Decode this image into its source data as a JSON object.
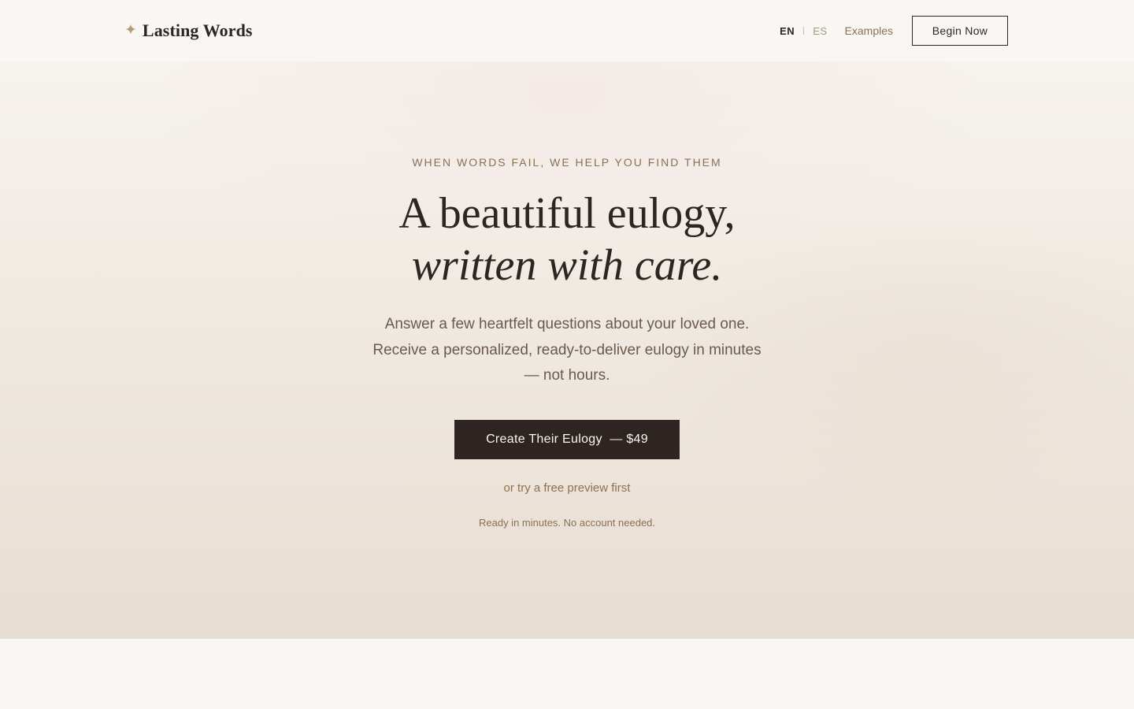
{
  "brand": {
    "icon": "sparkle-icon",
    "name": "Lasting Words",
    "accent_color": "#b59c7b"
  },
  "nav": {
    "languages": [
      "EN",
      "ES"
    ],
    "active_language": "EN",
    "examples_label": "Examples",
    "begin_label": "Begin Now"
  },
  "hero": {
    "eyebrow": "WHEN WORDS FAIL, WE HELP YOU FIND THEM",
    "headline_line1": "A beautiful eulogy,",
    "headline_line2": "written with care.",
    "subcopy_line1": "Answer a few heartfelt questions about your loved one.",
    "subcopy_line2": "Receive a personalized, ready-to-deliver eulogy in minutes",
    "subcopy_line3": "— not hours.",
    "cta_label": "Create Their Eulogy  — $49",
    "preview_label": "or try a free preview first",
    "note": "Ready in minutes. No account needed."
  },
  "colors": {
    "text_dark": "#2e2522",
    "accent_brown": "#8b7150",
    "background": "#f9f7f4"
  }
}
